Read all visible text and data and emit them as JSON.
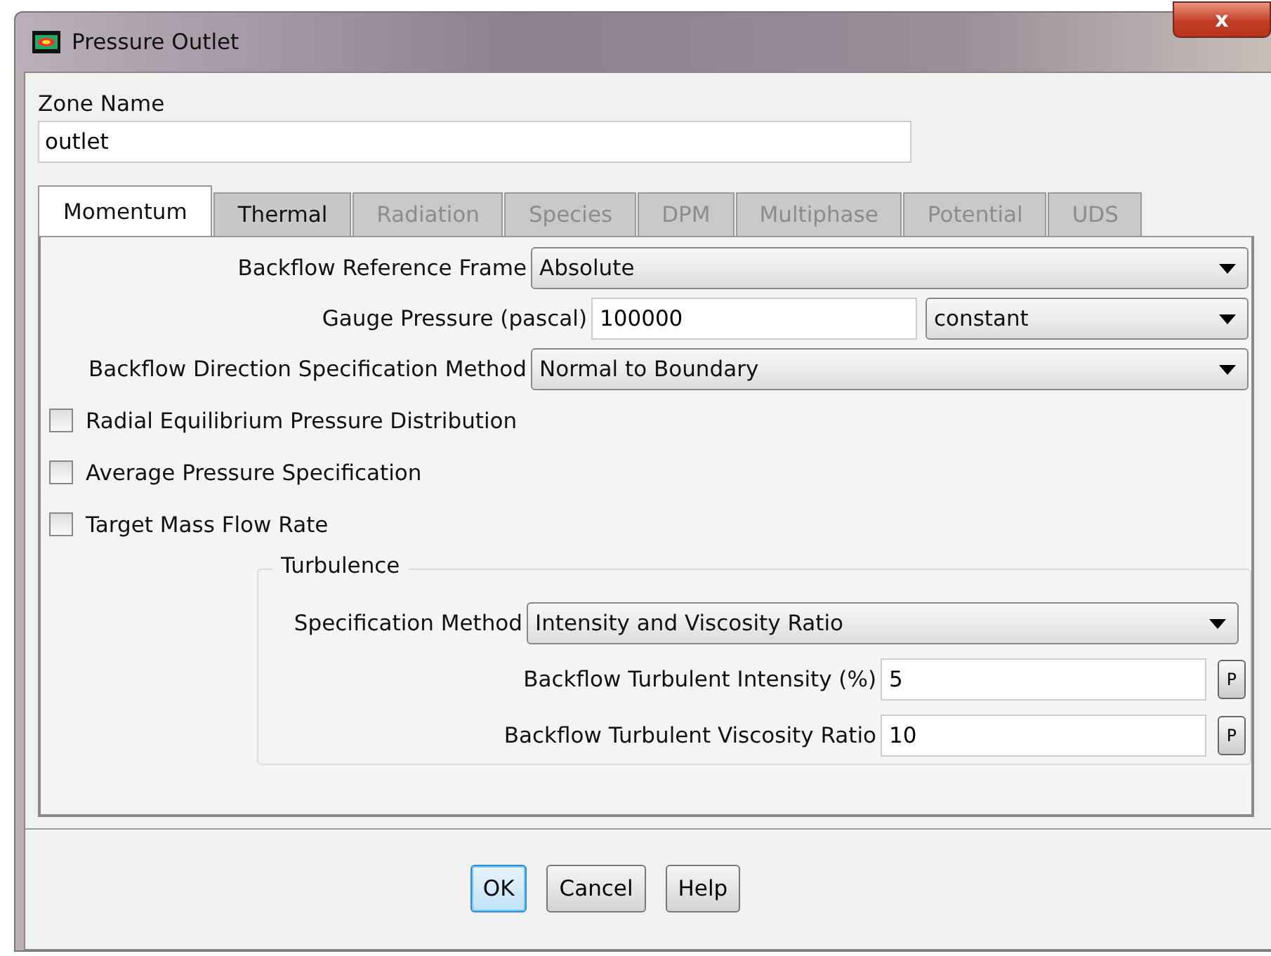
{
  "window": {
    "title": "Pressure Outlet",
    "close": "x"
  },
  "zone_name": {
    "label": "Zone Name",
    "value": "outlet"
  },
  "tabs": [
    {
      "label": "Momentum",
      "selected": true,
      "disabled": false
    },
    {
      "label": "Thermal",
      "selected": false,
      "disabled": false
    },
    {
      "label": "Radiation",
      "selected": false,
      "disabled": true
    },
    {
      "label": "Species",
      "selected": false,
      "disabled": true
    },
    {
      "label": "DPM",
      "selected": false,
      "disabled": true
    },
    {
      "label": "Multiphase",
      "selected": false,
      "disabled": true
    },
    {
      "label": "Potential",
      "selected": false,
      "disabled": true
    },
    {
      "label": "UDS",
      "selected": false,
      "disabled": true
    }
  ],
  "rows": [
    {
      "kind": "select",
      "label": "Backflow Reference Frame",
      "value": "Absolute"
    },
    {
      "kind": "input_select",
      "label": "Gauge Pressure (pascal)",
      "value": "100000",
      "option": "constant"
    },
    {
      "kind": "select",
      "label": "Backflow Direction Specification Method",
      "value": "Normal to Boundary"
    }
  ],
  "checkboxes": [
    {
      "label": "Radial Equilibrium Pressure Distribution",
      "checked": false
    },
    {
      "label": "Average Pressure Specification",
      "checked": false
    },
    {
      "label": "Target Mass Flow Rate",
      "checked": false
    }
  ],
  "turbulence": {
    "title": "Turbulence",
    "rows": [
      {
        "kind": "select",
        "label": "Specification Method",
        "value": "Intensity and Viscosity Ratio"
      },
      {
        "kind": "input_p",
        "label": "Backflow Turbulent Intensity (%)",
        "value": "5",
        "button": "P"
      },
      {
        "kind": "input_p",
        "label": "Backflow Turbulent Viscosity Ratio",
        "value": "10",
        "button": "P"
      }
    ]
  },
  "buttons": [
    {
      "label": "OK",
      "focused": true
    },
    {
      "label": "Cancel",
      "focused": false
    },
    {
      "label": "Help",
      "focused": false
    }
  ]
}
